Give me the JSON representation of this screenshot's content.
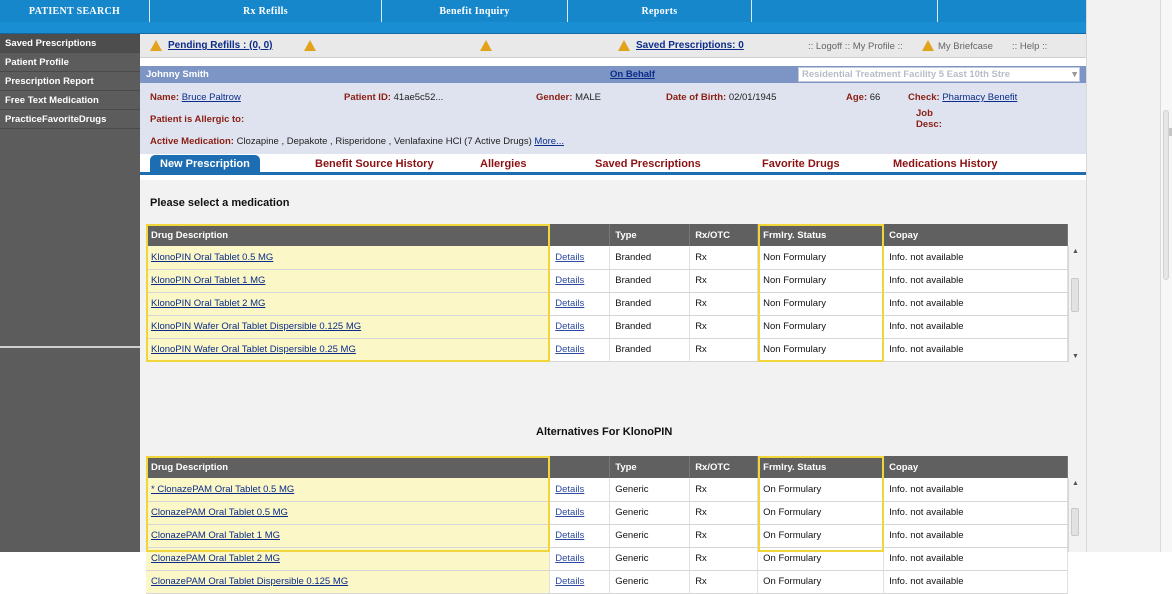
{
  "nav": {
    "items": [
      "PATIENT SEARCH",
      "Rx Refills",
      "Benefit Inquiry",
      "Reports"
    ]
  },
  "sidebar": {
    "items": [
      {
        "label": "Saved Prescriptions"
      },
      {
        "label": "Patient Profile"
      },
      {
        "label": "Prescription Report"
      },
      {
        "label": "Free Text Medication"
      },
      {
        "label": "PracticeFavoriteDrugs"
      }
    ]
  },
  "alerts": {
    "pending_refills": "Pending Refills : (0, 0)",
    "saved_prescriptions": "Saved Prescriptions: 0",
    "links_left": ":: Logoff :: My Profile ::",
    "my_briefcase": "My Briefcase",
    "help": ":: Help ::"
  },
  "patient": {
    "header_name": "Johnny Smith",
    "on_behalf": "On Behalf",
    "facility": "Residential Treatment Facility 5 East 10th Stre",
    "name_label": "Name:",
    "name_value": "Bruce Paltrow",
    "id_label": "Patient ID:",
    "id_value": "41ae5c52...",
    "gender_label": "Gender:",
    "gender_value": "MALE",
    "dob_label": "Date of Birth:",
    "dob_value": "02/01/1945",
    "age_label": "Age:",
    "age_value": "66",
    "check_label": "Check:",
    "check_value": "Pharmacy Benefit",
    "allergic_label": "Patient is Allergic to:",
    "job_label": "Job",
    "desc_label": "Desc:",
    "active_med_label": "Active Medication:",
    "active_med_value": "Clozapine , Depakote , Risperidone , Venlafaxine HCl (7 Active Drugs)",
    "more_link": "More..."
  },
  "tabs": [
    {
      "label": "New Prescription"
    },
    {
      "label": "Benefit Source History"
    },
    {
      "label": "Allergies"
    },
    {
      "label": "Saved Prescriptions"
    },
    {
      "label": "Favorite Drugs"
    },
    {
      "label": "Medications History"
    }
  ],
  "medications": {
    "title": "Please select a medication",
    "columns": [
      "Drug Description",
      "",
      "Type",
      "Rx/OTC",
      "Frmlry. Status",
      "Copay"
    ],
    "rows": [
      {
        "drug": "KlonoPIN Oral Tablet 0.5 MG",
        "details": "Details",
        "type": "Branded",
        "rx": "Rx",
        "status": "Non Formulary",
        "copay": "Info. not available"
      },
      {
        "drug": "KlonoPIN Oral Tablet 1 MG",
        "details": "Details",
        "type": "Branded",
        "rx": "Rx",
        "status": "Non Formulary",
        "copay": "Info. not available"
      },
      {
        "drug": "KlonoPIN Oral Tablet 2 MG",
        "details": "Details",
        "type": "Branded",
        "rx": "Rx",
        "status": "Non Formulary",
        "copay": "Info. not available"
      },
      {
        "drug": "KlonoPIN Wafer Oral Tablet Dispersible 0.125 MG",
        "details": "Details",
        "type": "Branded",
        "rx": "Rx",
        "status": "Non Formulary",
        "copay": "Info. not available"
      },
      {
        "drug": "KlonoPIN Wafer Oral Tablet Dispersible 0.25 MG",
        "details": "Details",
        "type": "Branded",
        "rx": "Rx",
        "status": "Non Formulary",
        "copay": "Info. not available"
      }
    ]
  },
  "alternatives": {
    "title": "Alternatives For KlonoPIN",
    "columns": [
      "Drug Description",
      "",
      "Type",
      "Rx/OTC",
      "Frmlry. Status",
      "Copay"
    ],
    "rows": [
      {
        "drug": "* ClonazePAM Oral Tablet 0.5 MG",
        "details": "Details",
        "type": "Generic",
        "rx": "Rx",
        "status": "On Formulary",
        "copay": "Info. not available"
      },
      {
        "drug": "ClonazePAM Oral Tablet 0.5 MG",
        "details": "Details",
        "type": "Generic",
        "rx": "Rx",
        "status": "On Formulary",
        "copay": "Info. not available"
      },
      {
        "drug": "ClonazePAM Oral Tablet 1 MG",
        "details": "Details",
        "type": "Generic",
        "rx": "Rx",
        "status": "On Formulary",
        "copay": "Info. not available"
      },
      {
        "drug": "ClonazePAM Oral Tablet 2 MG",
        "details": "Details",
        "type": "Generic",
        "rx": "Rx",
        "status": "On Formulary",
        "copay": "Info. not available"
      },
      {
        "drug": "ClonazePAM Oral Tablet Dispersible 0.125 MG",
        "details": "Details",
        "type": "Generic",
        "rx": "Rx",
        "status": "On Formulary",
        "copay": "Info. not available"
      }
    ]
  },
  "colors": {
    "nav_blue": "#1a8ed3",
    "sidebar_gray": "#5c5c5c",
    "tab_blue": "#1c6db2",
    "highlight_yellow": "#f0d63a"
  },
  "icons": [
    "warning-icon",
    "briefcase-icon",
    "dropdown-arrow-icon"
  ]
}
